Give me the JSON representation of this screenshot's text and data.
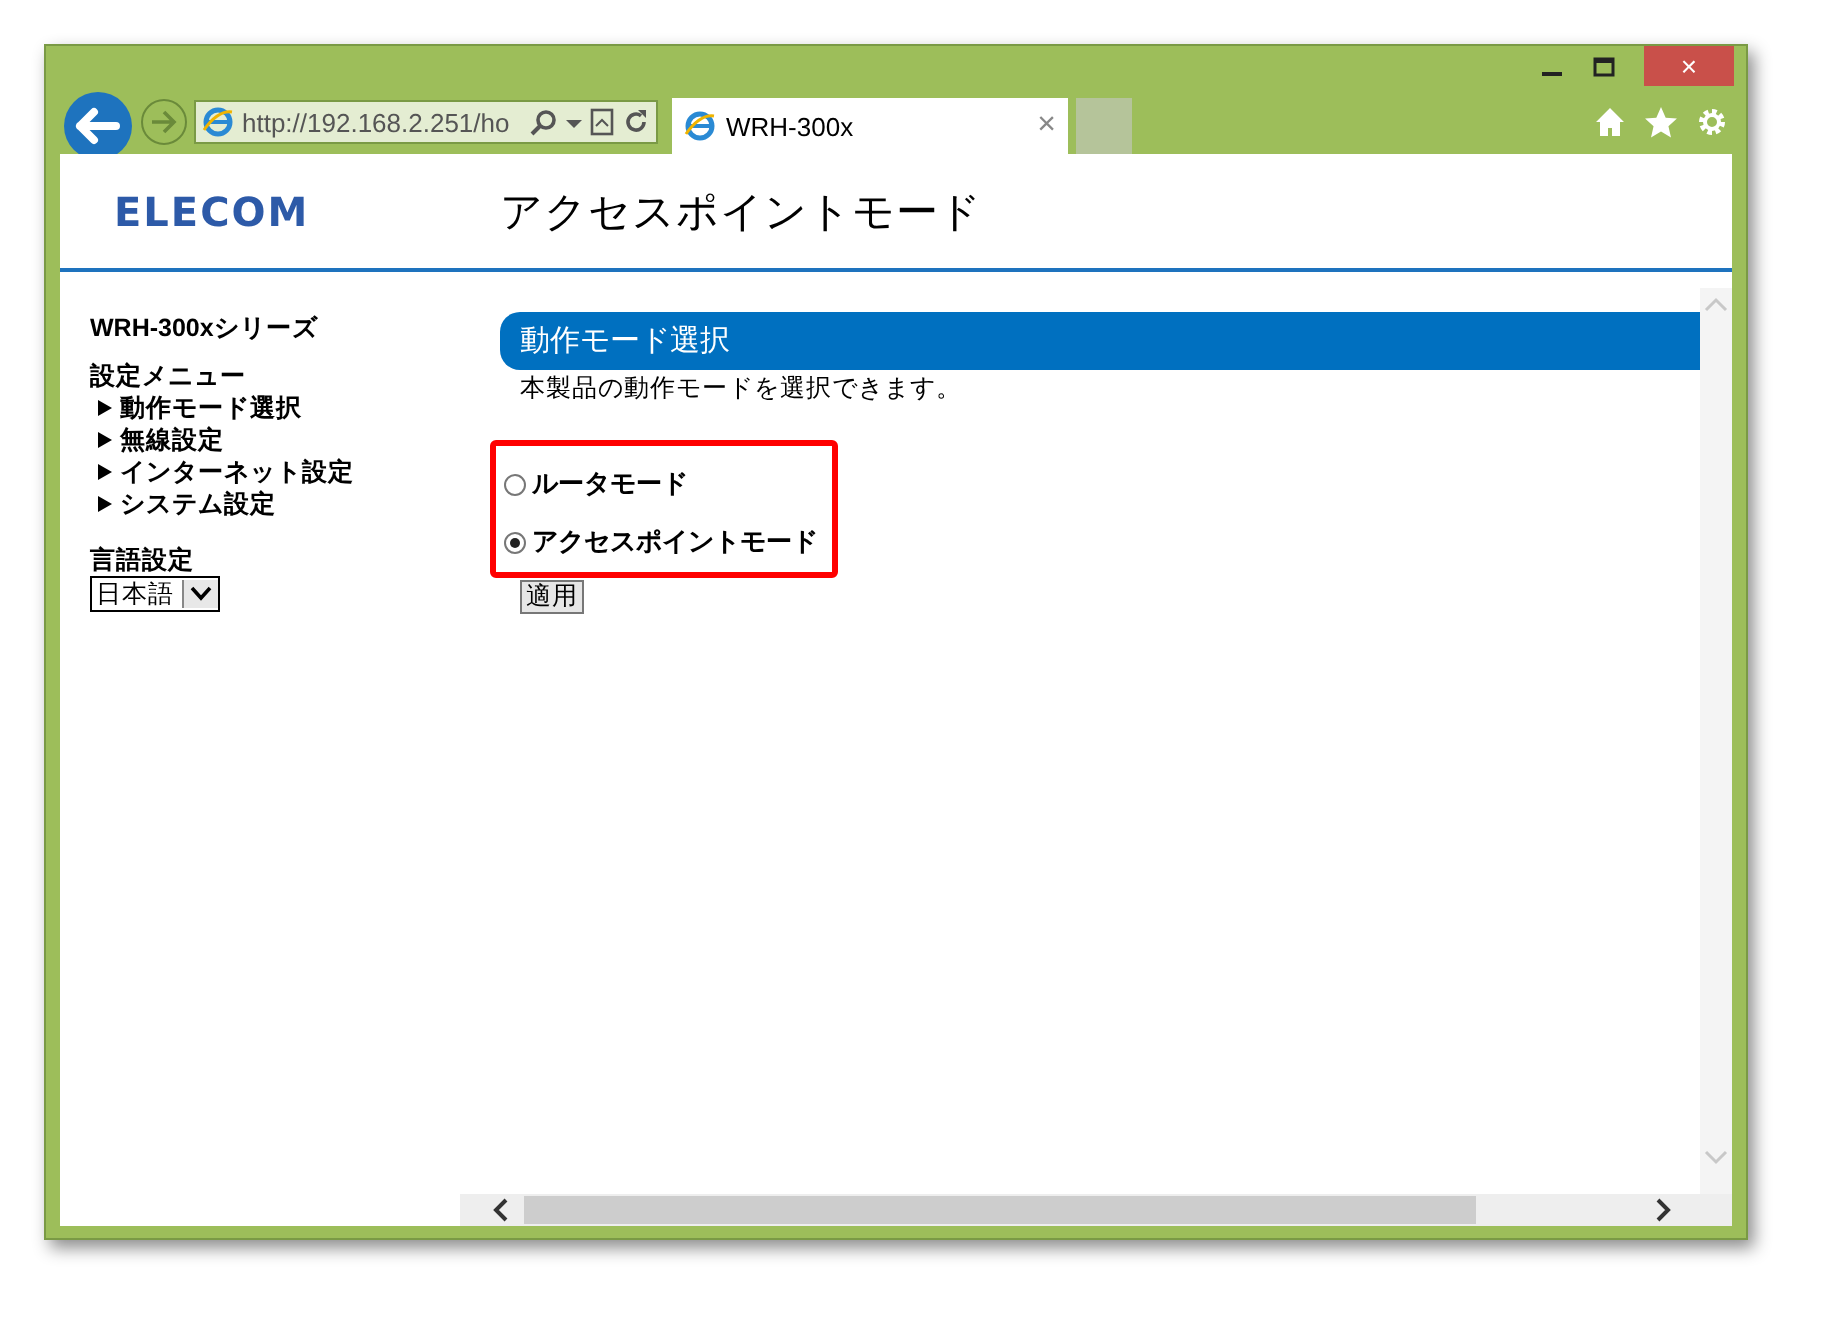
{
  "browser": {
    "address": "http://192.168.2.251/ho",
    "tab": {
      "title": "WRH-300x",
      "close": "×"
    },
    "close_symbol": "×"
  },
  "header": {
    "logo": "ELECOM",
    "title": "アクセスポイントモード"
  },
  "sidebar": {
    "series": "WRH-300xシリーズ",
    "menu_title": "設定メニュー",
    "menu_items": [
      {
        "label": "動作モード選択"
      },
      {
        "label": "無線設定"
      },
      {
        "label": "インターネット設定"
      },
      {
        "label": "システム設定"
      }
    ],
    "language_label": "言語設定",
    "language_value": "日本語"
  },
  "main": {
    "section_title": "動作モード選択",
    "description": "本製品の動作モードを選択できます。",
    "options": [
      {
        "label": "ルータモード",
        "selected": false
      },
      {
        "label": "アクセスポイントモード",
        "selected": true
      }
    ],
    "apply_button": "適用"
  }
}
